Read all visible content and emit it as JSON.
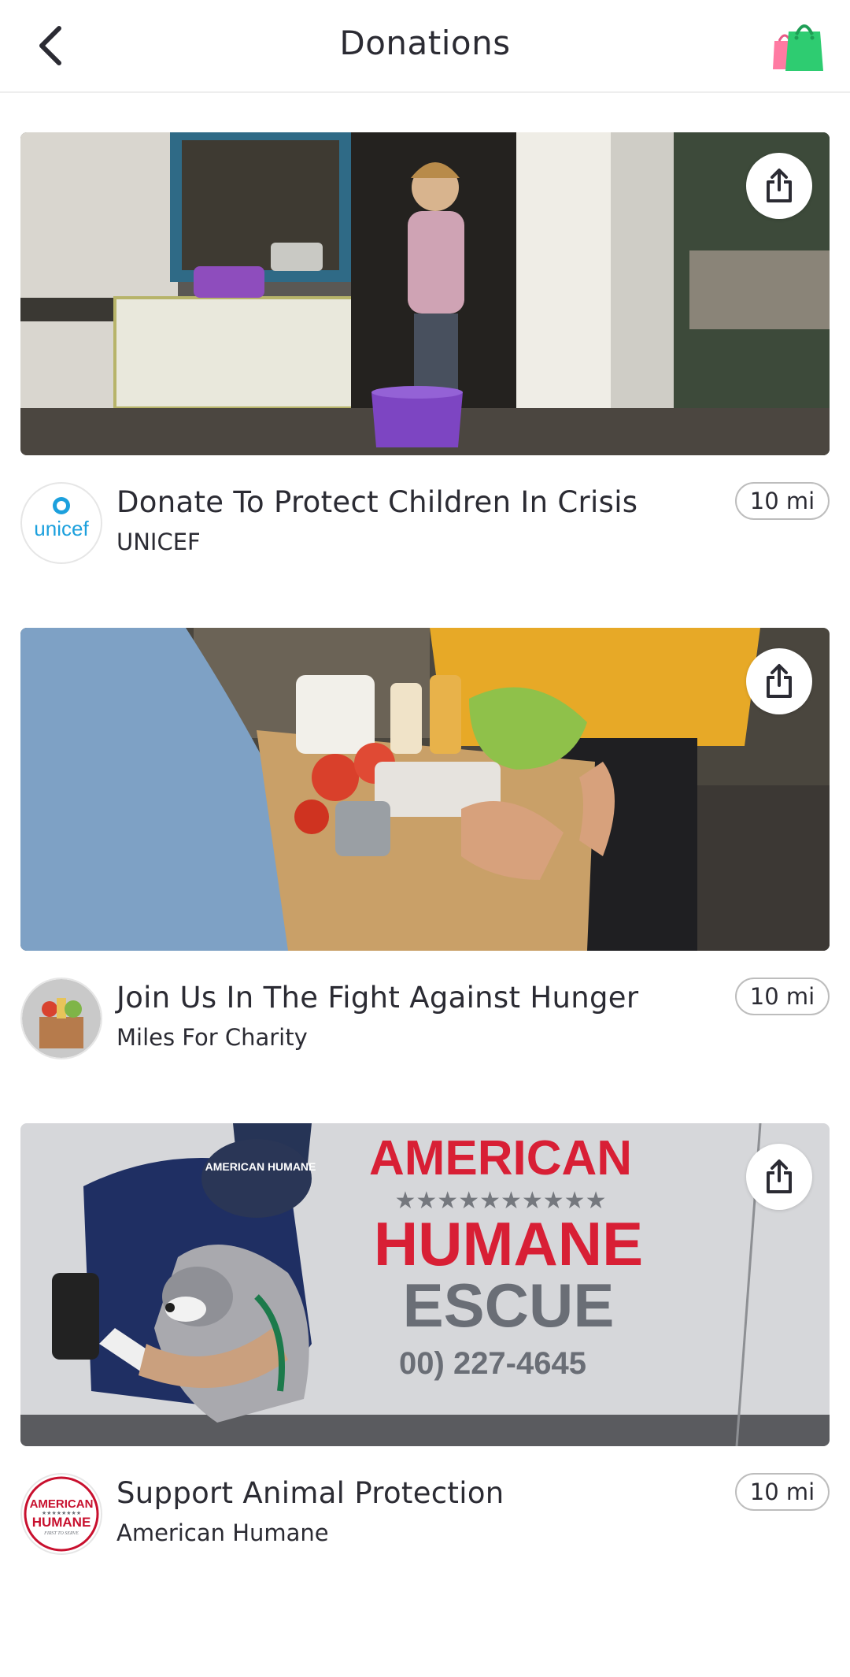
{
  "header": {
    "title": "Donations"
  },
  "cards": [
    {
      "title": "Donate To Protect Children In Crisis",
      "org": "UNICEF",
      "distance": "10 mi",
      "logo_text": "unicef"
    },
    {
      "title": "Join Us In The Fight Against Hunger",
      "org": "Miles For Charity",
      "distance": "10 mi"
    },
    {
      "title": "Support Animal Protection",
      "org": "American Humane",
      "distance": "10 mi",
      "image_text": {
        "line1": "AMERICAN",
        "line2": "HUMANE",
        "line3": "ESCUE",
        "phone": "00) 227-4645",
        "cap": "AMERICAN HUMANE"
      },
      "logo_text": {
        "line1": "AMERICAN",
        "line2": "HUMANE",
        "line3": "FIRST TO SERVE"
      }
    }
  ],
  "colors": {
    "text": "#2b2b33",
    "unicef_blue": "#1ca0dd",
    "humane_red": "#c8102e",
    "bag_green": "#2ecc71",
    "bag_pink": "#ff7aa2"
  }
}
